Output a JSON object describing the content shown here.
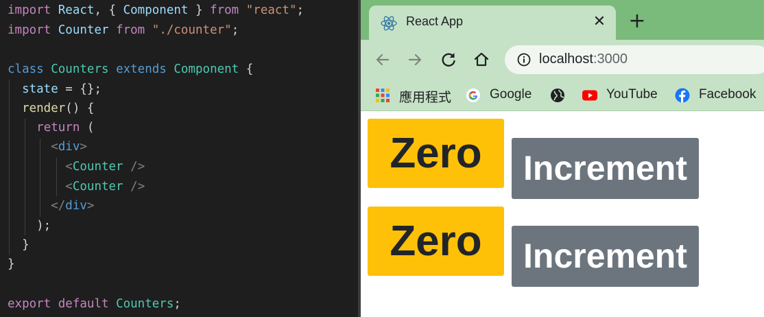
{
  "editor": {
    "lines": [
      [
        {
          "c": "k",
          "t": "import"
        },
        {
          "c": "p",
          "t": " "
        },
        {
          "c": "i",
          "t": "React"
        },
        {
          "c": "p",
          "t": ", { "
        },
        {
          "c": "i",
          "t": "Component"
        },
        {
          "c": "p",
          "t": " } "
        },
        {
          "c": "k",
          "t": "from"
        },
        {
          "c": "p",
          "t": " "
        },
        {
          "c": "s",
          "t": "\"react\""
        },
        {
          "c": "p",
          "t": ";"
        }
      ],
      [
        {
          "c": "k",
          "t": "import"
        },
        {
          "c": "p",
          "t": " "
        },
        {
          "c": "i",
          "t": "Counter"
        },
        {
          "c": "p",
          "t": " "
        },
        {
          "c": "k",
          "t": "from"
        },
        {
          "c": "p",
          "t": " "
        },
        {
          "c": "s",
          "t": "\"./counter\""
        },
        {
          "c": "p",
          "t": ";"
        }
      ],
      [],
      [
        {
          "c": "b",
          "t": "class"
        },
        {
          "c": "p",
          "t": " "
        },
        {
          "c": "t",
          "t": "Counters"
        },
        {
          "c": "p",
          "t": " "
        },
        {
          "c": "b",
          "t": "extends"
        },
        {
          "c": "p",
          "t": " "
        },
        {
          "c": "t",
          "t": "Component"
        },
        {
          "c": "p",
          "t": " {"
        }
      ],
      [
        {
          "c": "p",
          "t": "  "
        },
        {
          "c": "i",
          "t": "state"
        },
        {
          "c": "p",
          "t": " = {};"
        }
      ],
      [
        {
          "c": "p",
          "t": "  "
        },
        {
          "c": "f",
          "t": "render"
        },
        {
          "c": "p",
          "t": "() {"
        }
      ],
      [
        {
          "c": "p",
          "t": "    "
        },
        {
          "c": "k",
          "t": "return"
        },
        {
          "c": "p",
          "t": " ("
        }
      ],
      [
        {
          "c": "p",
          "t": "      "
        },
        {
          "c": "g",
          "t": "<"
        },
        {
          "c": "b",
          "t": "div"
        },
        {
          "c": "g",
          "t": ">"
        }
      ],
      [
        {
          "c": "p",
          "t": "        "
        },
        {
          "c": "g",
          "t": "<"
        },
        {
          "c": "t",
          "t": "Counter"
        },
        {
          "c": "p",
          "t": " "
        },
        {
          "c": "g",
          "t": "/>"
        }
      ],
      [
        {
          "c": "p",
          "t": "        "
        },
        {
          "c": "g",
          "t": "<"
        },
        {
          "c": "t",
          "t": "Counter"
        },
        {
          "c": "p",
          "t": " "
        },
        {
          "c": "g",
          "t": "/>"
        }
      ],
      [
        {
          "c": "p",
          "t": "      "
        },
        {
          "c": "g",
          "t": "</"
        },
        {
          "c": "b",
          "t": "div"
        },
        {
          "c": "g",
          "t": ">"
        }
      ],
      [
        {
          "c": "p",
          "t": "    );"
        }
      ],
      [
        {
          "c": "p",
          "t": "  }"
        }
      ],
      [
        {
          "c": "p",
          "t": "}"
        }
      ],
      [],
      [
        {
          "c": "k",
          "t": "export"
        },
        {
          "c": "p",
          "t": " "
        },
        {
          "c": "k",
          "t": "default"
        },
        {
          "c": "p",
          "t": " "
        },
        {
          "c": "t",
          "t": "Counters"
        },
        {
          "c": "p",
          "t": ";"
        }
      ]
    ]
  },
  "browser": {
    "tab": {
      "title": "React App",
      "icon": "react-logo-icon",
      "close_label": "✕"
    },
    "new_tab_label": "+",
    "toolbar": {
      "back_icon": "arrow-left-icon",
      "forward_icon": "arrow-right-icon",
      "reload_icon": "reload-icon",
      "home_icon": "home-icon",
      "site_info_icon": "info-icon",
      "url_host": "localhost",
      "url_port": ":3000"
    },
    "bookmarks": [
      {
        "label": "應用程式",
        "icon": "apps-grid-icon"
      },
      {
        "label": "Google",
        "icon": "google-icon"
      },
      {
        "label": "",
        "icon": "globe-icon"
      },
      {
        "label": "YouTube",
        "icon": "youtube-icon"
      },
      {
        "label": "Facebook",
        "icon": "facebook-icon"
      }
    ],
    "counters": [
      {
        "badge": "Zero",
        "button": "Increment"
      },
      {
        "badge": "Zero",
        "button": "Increment"
      }
    ]
  },
  "colors": {
    "badge_bg": "#ffc107",
    "button_bg": "#6c757d",
    "chrome_frame": "#7aba7a",
    "chrome_toolbar": "#c6e2c6",
    "editor_bg": "#1e1e1e"
  }
}
